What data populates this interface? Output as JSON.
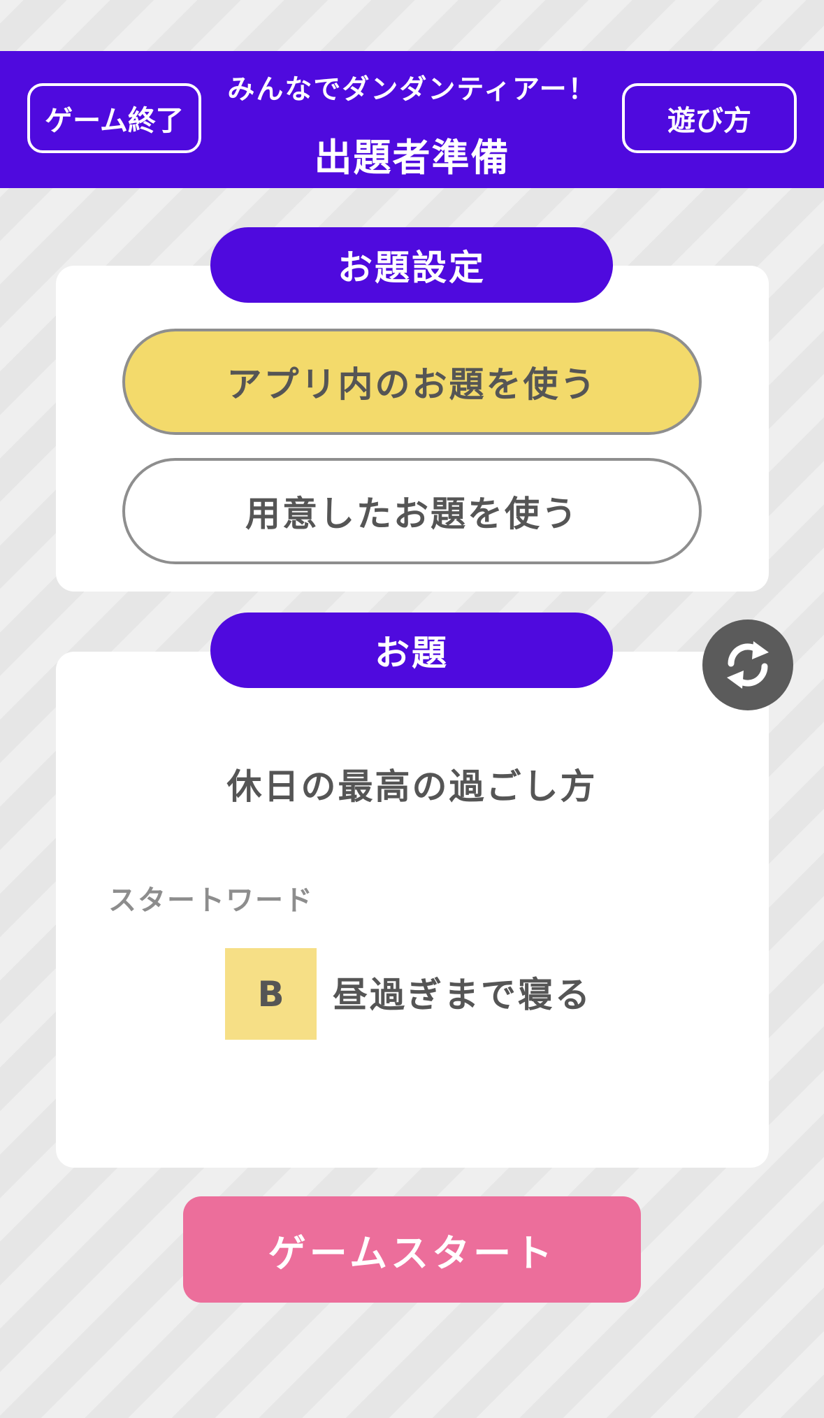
{
  "header": {
    "subtitle": "みんなでダンダンティアー！",
    "title": "出題者準備",
    "end_game_label": "ゲーム終了",
    "how_to_play_label": "遊び方",
    "background_color": "#4f0ade"
  },
  "settings": {
    "section_label": "お題設定",
    "options": [
      {
        "label": "アプリ内のお題を使う",
        "selected": true
      },
      {
        "label": "用意したお題を使う",
        "selected": false
      }
    ],
    "selected_color": "#f3da6b"
  },
  "topic": {
    "section_label": "お題",
    "text": "休日の最高の過ごし方",
    "refresh_icon": "refresh-icon",
    "start_word_label": "スタートワード",
    "start_word": {
      "badge": "B",
      "text": "昼過ぎまで寝る",
      "badge_color": "#f6df86"
    }
  },
  "footer": {
    "start_label": "ゲームスタート",
    "start_color": "#ec6e9b"
  }
}
